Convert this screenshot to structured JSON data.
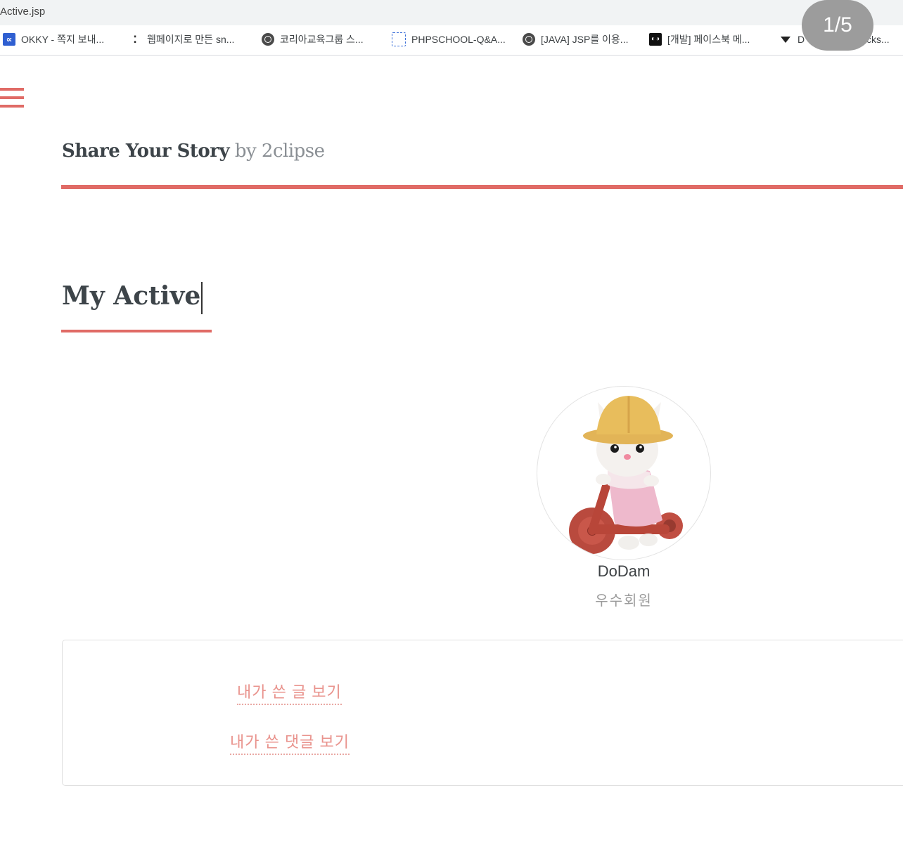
{
  "browser": {
    "url": "Active.jsp",
    "bookmarks": [
      {
        "label": "OKKY - 쪽지 보내...",
        "icon": "okky-icon"
      },
      {
        "label": "웹페이지로 만든 sn...",
        "icon": "dots-icon"
      },
      {
        "label": "코리아교육그룹 스...",
        "icon": "globe-icon"
      },
      {
        "label": "PHPSCHOOL-Q&A...",
        "icon": "php-icon"
      },
      {
        "label": "[JAVA] JSP를 이용...",
        "icon": "globe-icon"
      },
      {
        "label": "[개발] 페이스북 메...",
        "icon": "blog-icon"
      },
      {
        "label": "D",
        "icon": "hat-icon"
      },
      {
        "label": "cks...",
        "icon": ""
      }
    ]
  },
  "pager": {
    "label": "1/5"
  },
  "site": {
    "title_strong": "Share Your Story",
    "title_by": "by 2clipse"
  },
  "page": {
    "heading": "My Active"
  },
  "profile": {
    "username": "DoDam",
    "grade": "우수회원"
  },
  "activity": {
    "my_posts": "내가 쓴 글 보기",
    "my_comments": "내가 쓴 댓글 보기"
  },
  "colors": {
    "accent": "#e06b66",
    "link": "#e9938d"
  }
}
